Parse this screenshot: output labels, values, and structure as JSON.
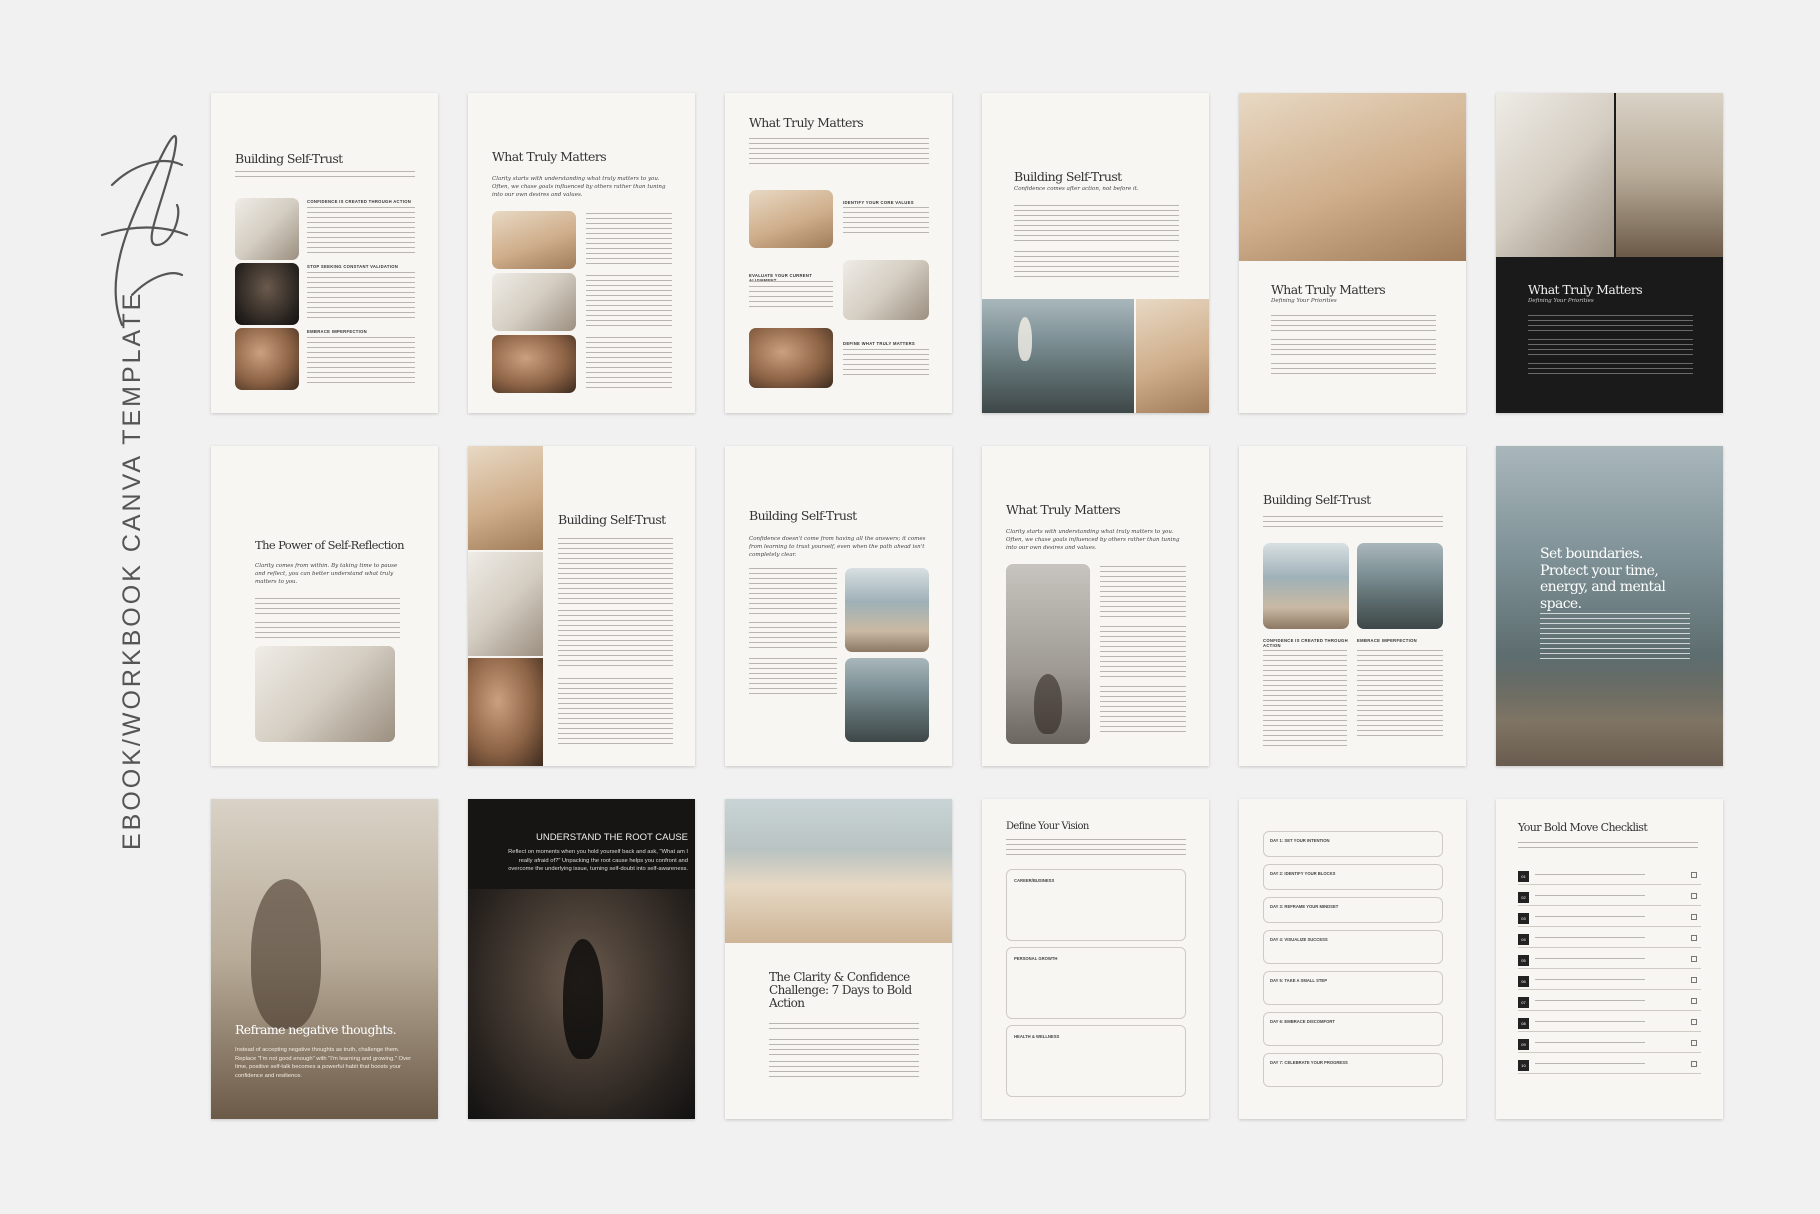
{
  "brand": {
    "script_name": "Aurelle",
    "side_title": "EBOOK/WORKBOOK CANVA TEMPLATE"
  },
  "pages": {
    "p1": {
      "title": "Building Self-Trust",
      "caps": [
        "CONFIDENCE IS CREATED THROUGH ACTION",
        "STOP SEEKING CONSTANT VALIDATION",
        "EMBRACE IMPERFECTION"
      ]
    },
    "p2": {
      "title": "What Truly Matters",
      "sub": "Clarity starts with understanding what truly matters to you. Often, we chase goals influenced by others rather than tuning into our own desires and values."
    },
    "p3": {
      "title": "What Truly Matters",
      "caps": [
        "IDENTIFY YOUR CORE VALUES",
        "EVALUATE YOUR CURRENT ALIGNMENT",
        "DEFINE WHAT TRULY MATTERS"
      ]
    },
    "p4": {
      "title": "Building Self-Trust",
      "sub": "Confidence comes after action, not before it."
    },
    "p5": {
      "title": "What Truly Matters",
      "sub": "Defining Your Priorities"
    },
    "p6": {
      "title": "What Truly Matters",
      "sub": "Defining Your Priorities"
    },
    "p7": {
      "title": "The Power of Self-Reflection",
      "sub": "Clarity comes from within. By taking time to pause and reflect, you can better understand what truly matters to you."
    },
    "p8": {
      "title": "Building Self-Trust"
    },
    "p9": {
      "title": "Building Self-Trust",
      "sub": "Confidence doesn't come from having all the answers; it comes from learning to trust yourself, even when the path ahead isn't completely clear."
    },
    "p10": {
      "title": "What Truly Matters",
      "sub": "Clarity starts with understanding what truly matters to you. Often, we chase goals influenced by others rather than tuning into our own desires and values."
    },
    "p11": {
      "title": "Building Self-Trust",
      "caps": [
        "CONFIDENCE IS CREATED THROUGH ACTION",
        "EMBRACE IMPERFECTION"
      ]
    },
    "p12": {
      "title": "Set boundaries. Protect your time, energy, and mental space."
    },
    "p13": {
      "title": "Reframe negative thoughts.",
      "body": "Instead of accepting negative thoughts as truth, challenge them. Replace \"I'm not good enough\" with \"I'm learning and growing.\" Over time, positive self-talk becomes a powerful habit that boosts your confidence and resilience."
    },
    "p14": {
      "title": "UNDERSTAND THE ROOT CAUSE",
      "body": "Reflect on moments when you hold yourself back and ask, \"What am I really afraid of?\" Unpacking the root cause helps you confront and overcome the underlying issue, turning self-doubt into self-awareness."
    },
    "p15": {
      "title": "The Clarity & Confidence Challenge: 7 Days to Bold Action"
    },
    "p16": {
      "title": "Define Your Vision",
      "boxes": [
        "CAREER/BUSINESS",
        "PERSONAL GROWTH",
        "HEALTH & WELLNESS"
      ]
    },
    "p17": {
      "days": [
        "DAY 1: SET YOUR INTENTION",
        "DAY 2: IDENTIFY YOUR BLOCKS",
        "DAY 3: REFRAME YOUR MINDSET",
        "DAY 4: VISUALIZE SUCCESS",
        "DAY 5: TAKE A SMALL STEP",
        "DAY 6: EMBRACE DISCOMFORT",
        "DAY 7: CELEBRATE YOUR PROGRESS"
      ]
    },
    "p18": {
      "title": "Your Bold Move Checklist",
      "nums": [
        "01",
        "02",
        "03",
        "04",
        "05",
        "06",
        "07",
        "08",
        "09",
        "10"
      ]
    }
  }
}
